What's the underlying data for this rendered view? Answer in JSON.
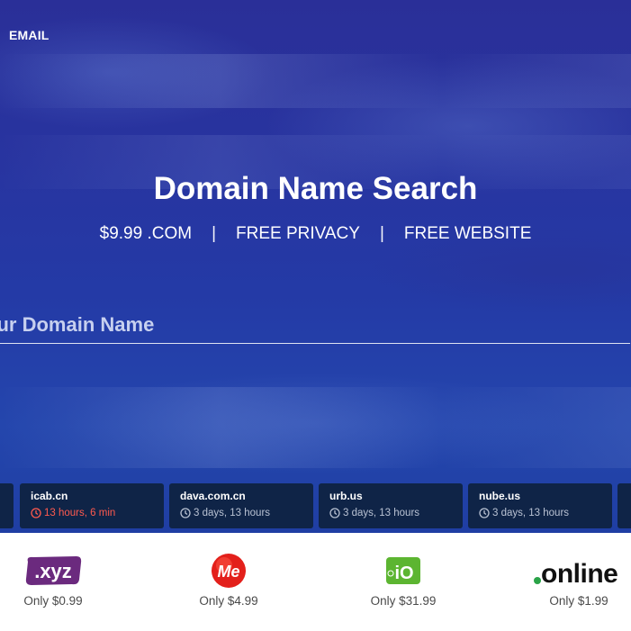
{
  "nav": {
    "email_label": "EMAIL"
  },
  "hero": {
    "title": "Domain Name Search",
    "features": [
      "$9.99 .COM",
      "FREE PRIVACY",
      "FREE WEBSITE"
    ],
    "separator": "|",
    "search_placeholder": "Your Domain Name"
  },
  "auctions": [
    {
      "domain": "icab.cn",
      "time": "13 hours, 6 min",
      "urgent": true
    },
    {
      "domain": "dava.com.cn",
      "time": "3 days, 13 hours",
      "urgent": false
    },
    {
      "domain": "urb.us",
      "time": "3 days, 13 hours",
      "urgent": false
    },
    {
      "domain": "nube.us",
      "time": "3 days, 13 hours",
      "urgent": false
    }
  ],
  "tlds": [
    {
      "name": ".xyz",
      "price": "Only $0.99",
      "color": "#6b2a7e"
    },
    {
      "name": "Me",
      "price": "Only $4.99",
      "color": "#e3201b"
    },
    {
      "name": "iO",
      "price": "Only $31.99",
      "color": "#5cb531"
    },
    {
      "name": "online",
      "price": "Only $1.99",
      "color": "#111111",
      "dot_color": "#2aa348"
    }
  ]
}
